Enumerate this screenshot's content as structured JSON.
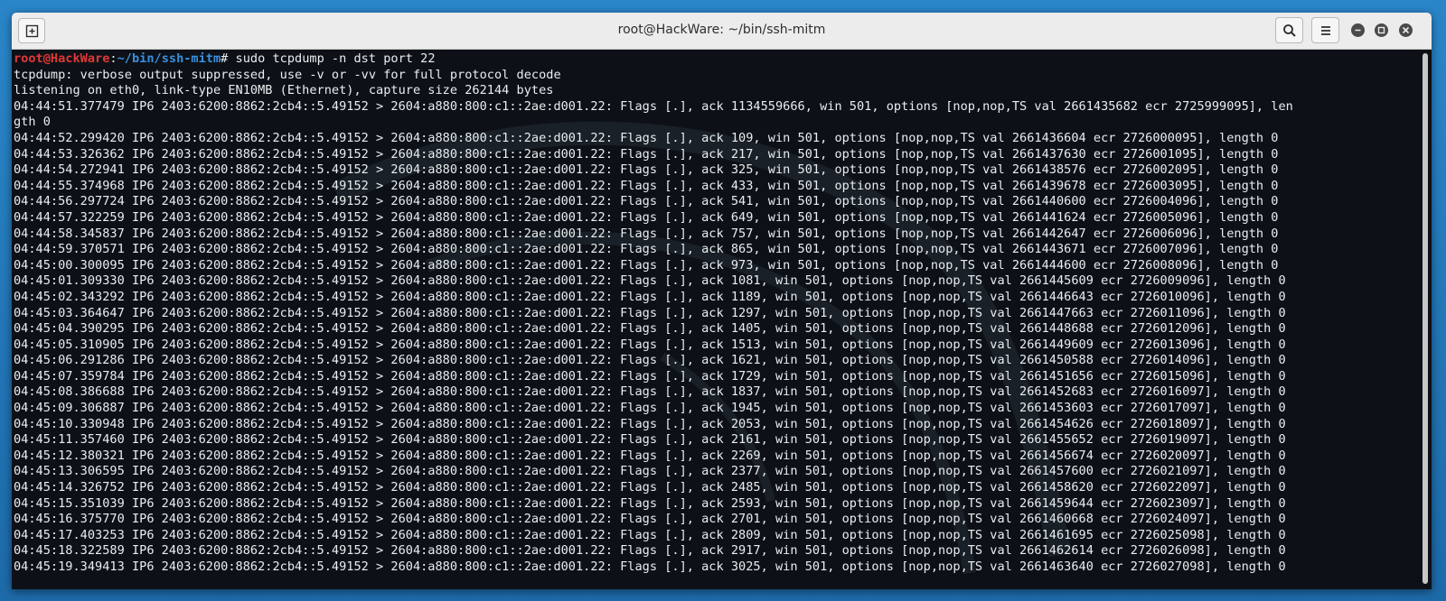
{
  "window": {
    "title": "root@HackWare: ~/bin/ssh-mitm"
  },
  "prompt": {
    "user_host": "root@HackWare",
    "sep": ":",
    "path": "~/bin/ssh-mitm",
    "symbol": "#",
    "command": " sudo tcpdump -n dst port 22"
  },
  "output": [
    "tcpdump: verbose output suppressed, use -v or -vv for full protocol decode",
    "listening on eth0, link-type EN10MB (Ethernet), capture size 262144 bytes",
    "04:44:51.377479 IP6 2403:6200:8862:2cb4::5.49152 > 2604:a880:800:c1::2ae:d001.22: Flags [.], ack 1134559666, win 501, options [nop,nop,TS val 2661435682 ecr 2725999095], len",
    "gth 0",
    "04:44:52.299420 IP6 2403:6200:8862:2cb4::5.49152 > 2604:a880:800:c1::2ae:d001.22: Flags [.], ack 109, win 501, options [nop,nop,TS val 2661436604 ecr 2726000095], length 0",
    "04:44:53.326362 IP6 2403:6200:8862:2cb4::5.49152 > 2604:a880:800:c1::2ae:d001.22: Flags [.], ack 217, win 501, options [nop,nop,TS val 2661437630 ecr 2726001095], length 0",
    "04:44:54.272941 IP6 2403:6200:8862:2cb4::5.49152 > 2604:a880:800:c1::2ae:d001.22: Flags [.], ack 325, win 501, options [nop,nop,TS val 2661438576 ecr 2726002095], length 0",
    "04:44:55.374968 IP6 2403:6200:8862:2cb4::5.49152 > 2604:a880:800:c1::2ae:d001.22: Flags [.], ack 433, win 501, options [nop,nop,TS val 2661439678 ecr 2726003095], length 0",
    "04:44:56.297724 IP6 2403:6200:8862:2cb4::5.49152 > 2604:a880:800:c1::2ae:d001.22: Flags [.], ack 541, win 501, options [nop,nop,TS val 2661440600 ecr 2726004096], length 0",
    "04:44:57.322259 IP6 2403:6200:8862:2cb4::5.49152 > 2604:a880:800:c1::2ae:d001.22: Flags [.], ack 649, win 501, options [nop,nop,TS val 2661441624 ecr 2726005096], length 0",
    "04:44:58.345837 IP6 2403:6200:8862:2cb4::5.49152 > 2604:a880:800:c1::2ae:d001.22: Flags [.], ack 757, win 501, options [nop,nop,TS val 2661442647 ecr 2726006096], length 0",
    "04:44:59.370571 IP6 2403:6200:8862:2cb4::5.49152 > 2604:a880:800:c1::2ae:d001.22: Flags [.], ack 865, win 501, options [nop,nop,TS val 2661443671 ecr 2726007096], length 0",
    "04:45:00.300095 IP6 2403:6200:8862:2cb4::5.49152 > 2604:a880:800:c1::2ae:d001.22: Flags [.], ack 973, win 501, options [nop,nop,TS val 2661444600 ecr 2726008096], length 0",
    "04:45:01.309330 IP6 2403:6200:8862:2cb4::5.49152 > 2604:a880:800:c1::2ae:d001.22: Flags [.], ack 1081, win 501, options [nop,nop,TS val 2661445609 ecr 2726009096], length 0",
    "04:45:02.343292 IP6 2403:6200:8862:2cb4::5.49152 > 2604:a880:800:c1::2ae:d001.22: Flags [.], ack 1189, win 501, options [nop,nop,TS val 2661446643 ecr 2726010096], length 0",
    "04:45:03.364647 IP6 2403:6200:8862:2cb4::5.49152 > 2604:a880:800:c1::2ae:d001.22: Flags [.], ack 1297, win 501, options [nop,nop,TS val 2661447663 ecr 2726011096], length 0",
    "04:45:04.390295 IP6 2403:6200:8862:2cb4::5.49152 > 2604:a880:800:c1::2ae:d001.22: Flags [.], ack 1405, win 501, options [nop,nop,TS val 2661448688 ecr 2726012096], length 0",
    "04:45:05.310905 IP6 2403:6200:8862:2cb4::5.49152 > 2604:a880:800:c1::2ae:d001.22: Flags [.], ack 1513, win 501, options [nop,nop,TS val 2661449609 ecr 2726013096], length 0",
    "04:45:06.291286 IP6 2403:6200:8862:2cb4::5.49152 > 2604:a880:800:c1::2ae:d001.22: Flags [.], ack 1621, win 501, options [nop,nop,TS val 2661450588 ecr 2726014096], length 0",
    "04:45:07.359784 IP6 2403:6200:8862:2cb4::5.49152 > 2604:a880:800:c1::2ae:d001.22: Flags [.], ack 1729, win 501, options [nop,nop,TS val 2661451656 ecr 2726015096], length 0",
    "04:45:08.386688 IP6 2403:6200:8862:2cb4::5.49152 > 2604:a880:800:c1::2ae:d001.22: Flags [.], ack 1837, win 501, options [nop,nop,TS val 2661452683 ecr 2726016097], length 0",
    "04:45:09.306887 IP6 2403:6200:8862:2cb4::5.49152 > 2604:a880:800:c1::2ae:d001.22: Flags [.], ack 1945, win 501, options [nop,nop,TS val 2661453603 ecr 2726017097], length 0",
    "04:45:10.330948 IP6 2403:6200:8862:2cb4::5.49152 > 2604:a880:800:c1::2ae:d001.22: Flags [.], ack 2053, win 501, options [nop,nop,TS val 2661454626 ecr 2726018097], length 0",
    "04:45:11.357460 IP6 2403:6200:8862:2cb4::5.49152 > 2604:a880:800:c1::2ae:d001.22: Flags [.], ack 2161, win 501, options [nop,nop,TS val 2661455652 ecr 2726019097], length 0",
    "04:45:12.380321 IP6 2403:6200:8862:2cb4::5.49152 > 2604:a880:800:c1::2ae:d001.22: Flags [.], ack 2269, win 501, options [nop,nop,TS val 2661456674 ecr 2726020097], length 0",
    "04:45:13.306595 IP6 2403:6200:8862:2cb4::5.49152 > 2604:a880:800:c1::2ae:d001.22: Flags [.], ack 2377, win 501, options [nop,nop,TS val 2661457600 ecr 2726021097], length 0",
    "04:45:14.326752 IP6 2403:6200:8862:2cb4::5.49152 > 2604:a880:800:c1::2ae:d001.22: Flags [.], ack 2485, win 501, options [nop,nop,TS val 2661458620 ecr 2726022097], length 0",
    "04:45:15.351039 IP6 2403:6200:8862:2cb4::5.49152 > 2604:a880:800:c1::2ae:d001.22: Flags [.], ack 2593, win 501, options [nop,nop,TS val 2661459644 ecr 2726023097], length 0",
    "04:45:16.375770 IP6 2403:6200:8862:2cb4::5.49152 > 2604:a880:800:c1::2ae:d001.22: Flags [.], ack 2701, win 501, options [nop,nop,TS val 2661460668 ecr 2726024097], length 0",
    "04:45:17.403253 IP6 2403:6200:8862:2cb4::5.49152 > 2604:a880:800:c1::2ae:d001.22: Flags [.], ack 2809, win 501, options [nop,nop,TS val 2661461695 ecr 2726025098], length 0",
    "04:45:18.322589 IP6 2403:6200:8862:2cb4::5.49152 > 2604:a880:800:c1::2ae:d001.22: Flags [.], ack 2917, win 501, options [nop,nop,TS val 2661462614 ecr 2726026098], length 0",
    "04:45:19.349413 IP6 2403:6200:8862:2cb4::5.49152 > 2604:a880:800:c1::2ae:d001.22: Flags [.], ack 3025, win 501, options [nop,nop,TS val 2661463640 ecr 2726027098], length 0"
  ],
  "colors": {
    "terminal_bg": "#0d1117",
    "terminal_fg": "#e9eef0",
    "prompt_user": "#e03838",
    "prompt_path": "#3a8fe0",
    "desktop_bg": "#1f6fb3"
  },
  "icons": {
    "new_tab": "new-tab-icon",
    "search": "search-icon",
    "menu": "hamburger-menu-icon",
    "minimize": "minimize-icon",
    "maximize": "maximize-icon",
    "close": "close-icon"
  }
}
